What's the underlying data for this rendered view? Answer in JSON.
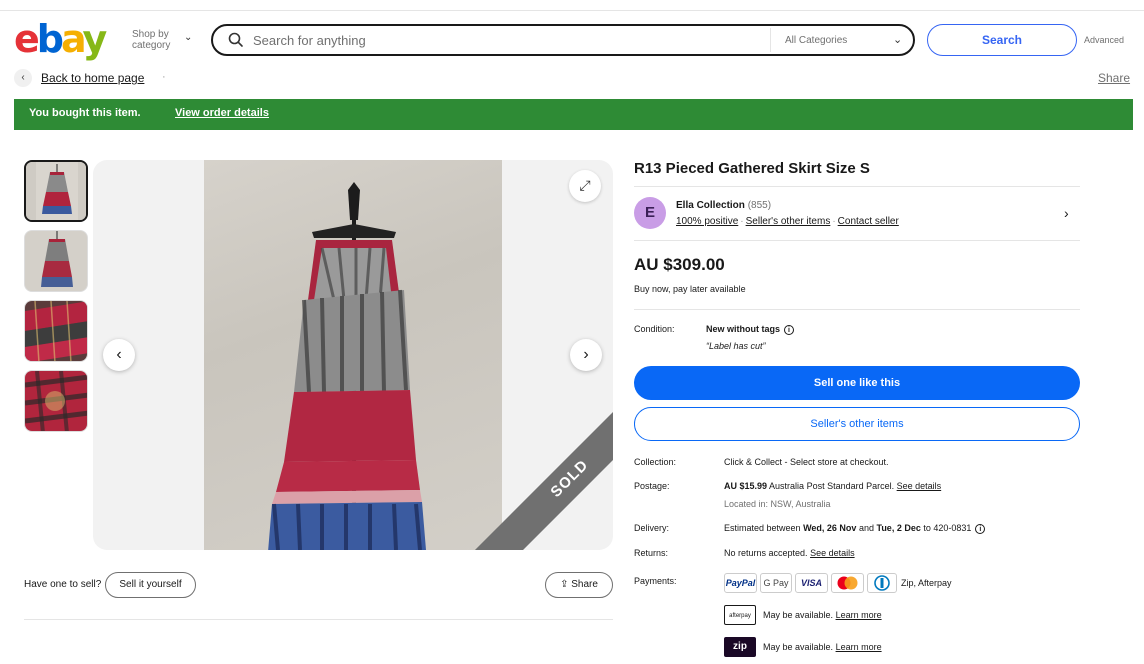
{
  "header": {
    "logo": [
      "e",
      "b",
      "a",
      "y"
    ],
    "shop_by_category": "Shop by category",
    "search_placeholder": "Search for anything",
    "category_select": "All Categories",
    "search_button": "Search",
    "advanced": "Advanced"
  },
  "breadcrumb": {
    "back_label": "Back to home page",
    "share_label": "Share"
  },
  "banner": {
    "message": "You bought this item.",
    "link": "View order details",
    "color": "#2e8b35"
  },
  "gallery": {
    "thumbnail_count": 4,
    "sold_label": "SOLD"
  },
  "sell_bar": {
    "prompt": "Have one to sell?",
    "sell_button": "Sell it yourself",
    "share_button": "Share"
  },
  "item": {
    "title": "R13 Pieced Gathered Skirt Size S",
    "price": "AU $309.00",
    "bnpl_text": "Buy now, pay later available"
  },
  "seller": {
    "initial": "E",
    "name": "Ella Collection",
    "feedback_count": "(855)",
    "positive": "100% positive",
    "other_items": "Seller's other items",
    "contact": "Contact seller",
    "avatar_color": "#c99de6"
  },
  "condition": {
    "label": "Condition:",
    "value": "New without tags",
    "note": "“Label has cut”"
  },
  "buttons": {
    "primary": "Sell one like this",
    "secondary": "Seller's other items",
    "primary_color": "#0968f6"
  },
  "details": {
    "collection_label": "Collection:",
    "collection_value": "Click & Collect - Select store at checkout.",
    "postage_label": "Postage:",
    "postage_price": "AU $15.99",
    "postage_service": "Australia Post Standard Parcel.",
    "postage_link": "See details",
    "located_in": "Located in: NSW, Australia",
    "delivery_label": "Delivery:",
    "delivery_prefix": "Estimated between",
    "delivery_start": "Wed, 26 Nov",
    "delivery_and": "and",
    "delivery_end": "Tue, 2 Dec",
    "delivery_to": "to 420-0831",
    "returns_label": "Returns:",
    "returns_value": "No returns accepted.",
    "returns_link": "See details",
    "payments_label": "Payments:",
    "payment_methods": [
      "PayPal",
      "G Pay",
      "VISA",
      "Mastercard",
      "Diners"
    ],
    "payment_extra": "Zip, Afterpay",
    "afterpay_logo": "afterpay",
    "afterpay_text": "May be available.",
    "afterpay_link": "Learn more",
    "zip_logo": "zip",
    "zip_text": "May be available.",
    "zip_link": "Learn more"
  }
}
